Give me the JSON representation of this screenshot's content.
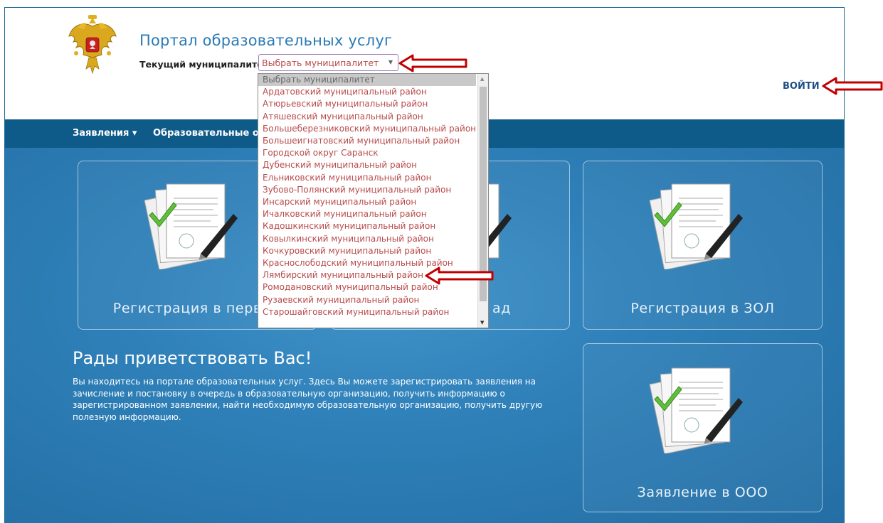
{
  "header": {
    "portal_title": "Портал образовательных услуг",
    "muni_label": "Текущий муниципалитет:",
    "muni_select_value": "Выбрать муниципалитет",
    "login_label": "ВОЙТИ"
  },
  "navbar": {
    "items": [
      "Заявления ▾",
      "Образовательные ор"
    ]
  },
  "dropdown": {
    "options": [
      "Выбрать муниципалитет",
      "Ардатовский муниципальный район",
      "Атюрьевский муниципальный район",
      "Атяшевский муниципальный район",
      "Большеберезниковский муниципальный район",
      "Большеигнатовский муниципальный район",
      "Городской округ Саранск",
      "Дубенский муниципальный район",
      "Ельниковский муниципальный район",
      "Зубово-Полянский муниципальный район",
      "Инсарский муниципальный район",
      "Ичалковский муниципальный район",
      "Кадошкинский муниципальный район",
      "Ковылкинский муниципальный район",
      "Кочкуровский муниципальный район",
      "Краснослободский муниципальный район",
      "Лямбирский муниципальный район",
      "Ромодановский муниципальный район",
      "Рузаевский муниципальный район",
      "Старошайговский муниципальный район"
    ]
  },
  "tiles": {
    "tile1_label": "Регистрация в первый",
    "tile2_label": "ад",
    "tile3_label": "Регистрация в ЗОЛ",
    "tile4_label": "Заявление в ООО"
  },
  "welcome": {
    "title": "Рады приветствовать Вас!",
    "text": "Вы находитесь на портале образовательных услуг. Здесь Вы можете зарегистрировать заявления на зачисление и постановку в очередь в образовательную организацию, получить информацию о зарегистрированном заявлении, найти необходимую образовательную организацию, получить другую полезную информацию."
  },
  "colors": {
    "brand_blue": "#2a7ab6",
    "nav_bg": "#0e5a88",
    "main_bg": "#2f80b9",
    "option_text": "#b84a4a",
    "arrow_red": "#c00000"
  },
  "icons": [
    "coat-of-arms-icon",
    "document-signature-icon",
    "red-arrow-icon"
  ]
}
